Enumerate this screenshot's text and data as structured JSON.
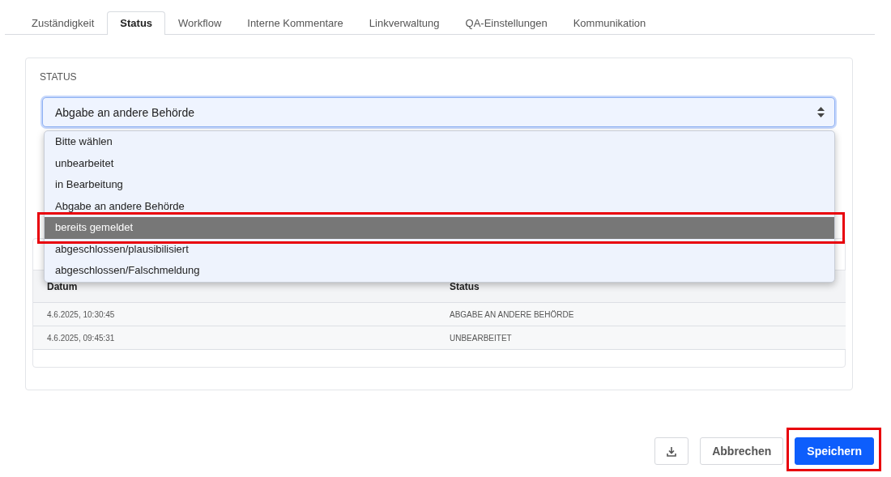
{
  "tabs": [
    {
      "label": "Zuständigkeit",
      "selected": false
    },
    {
      "label": "Status",
      "selected": true
    },
    {
      "label": "Workflow",
      "selected": false
    },
    {
      "label": "Interne Kommentare",
      "selected": false
    },
    {
      "label": "Linkverwaltung",
      "selected": false
    },
    {
      "label": "QA-Einstellungen",
      "selected": false
    },
    {
      "label": "Kommunikation",
      "selected": false
    }
  ],
  "status_section": {
    "heading": "STATUS",
    "select": {
      "value": "Abgabe an andere Behörde",
      "expanded": true
    },
    "options": [
      {
        "label": "Bitte wählen",
        "selected": false,
        "highlighted": false
      },
      {
        "label": "unbearbeitet",
        "selected": false,
        "highlighted": false
      },
      {
        "label": "in Bearbeitung",
        "selected": false,
        "highlighted": false
      },
      {
        "label": "Abgabe an andere Behörde",
        "selected": false,
        "highlighted": false
      },
      {
        "label": "bereits gemeldet",
        "selected": true,
        "highlighted": true
      },
      {
        "label": "abgeschlossen/plausibilisiert",
        "selected": false,
        "highlighted": false
      },
      {
        "label": "abgeschlossen/Falschmeldung",
        "selected": false,
        "highlighted": false
      }
    ],
    "history_table": {
      "columns": [
        "Datum",
        "Status"
      ],
      "rows": [
        [
          "4.6.2025, 10:30:45",
          "ABGABE AN ANDERE BEHÖRDE"
        ],
        [
          "4.6.2025, 09:45:31",
          "UNBEARBEITET"
        ]
      ]
    }
  },
  "buttons": [
    {
      "kind": "download",
      "highlighted": false
    },
    {
      "kind": "secondary",
      "label": "Abbrechen",
      "highlighted": false
    },
    {
      "kind": "primary",
      "label": "Speichern",
      "highlighted": true
    }
  ]
}
